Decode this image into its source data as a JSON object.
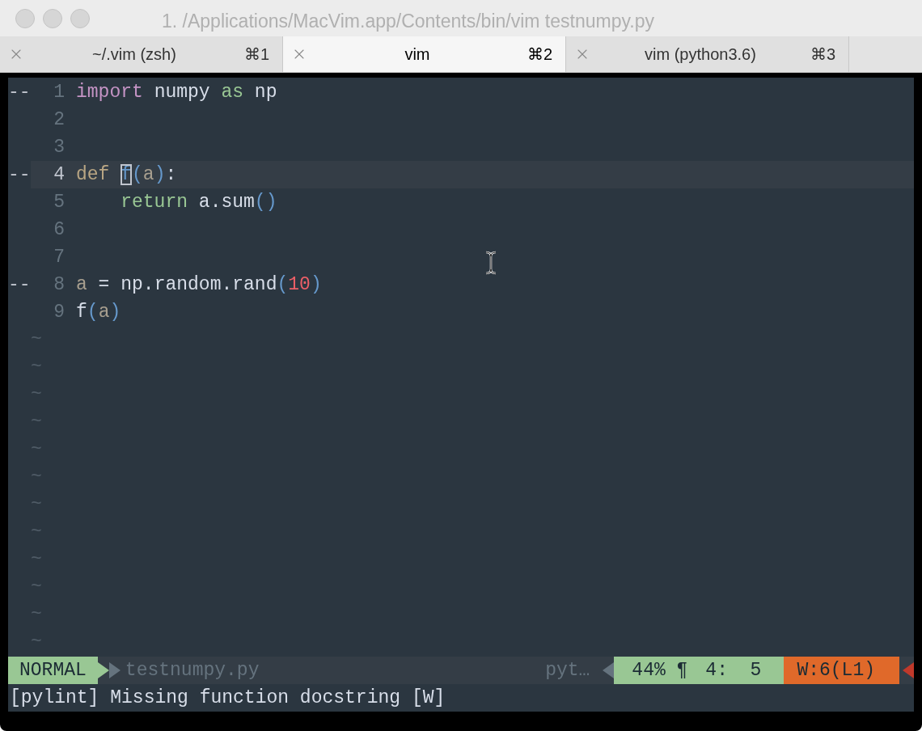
{
  "window": {
    "title": "1. /Applications/MacVim.app/Contents/bin/vim testnumpy.py"
  },
  "tabs": [
    {
      "label": "~/.vim (zsh)",
      "shortcut": "⌘1",
      "selected": false
    },
    {
      "label": "vim",
      "shortcut": "⌘2",
      "selected": true
    },
    {
      "label": "vim (python3.6)",
      "shortcut": "⌘3",
      "selected": false
    }
  ],
  "editor": {
    "lines": [
      {
        "number": "1",
        "sign": "--",
        "current": false,
        "tokens": [
          {
            "text": "import",
            "kind": "include"
          },
          {
            "text": " numpy ",
            "kind": "plain"
          },
          {
            "text": "as",
            "kind": "keyword"
          },
          {
            "text": " np",
            "kind": "plain"
          }
        ]
      },
      {
        "number": "2",
        "current": false
      },
      {
        "number": "3",
        "current": false
      },
      {
        "number": "4",
        "sign": "--",
        "current": true,
        "tokens": [
          {
            "text": "def ",
            "kind": "define"
          },
          {
            "text": "f",
            "kind": "cursor"
          },
          {
            "text": "(",
            "kind": "paren"
          },
          {
            "text": "a",
            "kind": "param"
          },
          {
            "text": ")",
            "kind": "paren"
          },
          {
            "text": ":",
            "kind": "plain"
          }
        ]
      },
      {
        "number": "5",
        "current": false,
        "tokens": [
          {
            "text": "    return",
            "kind": "keyword"
          },
          {
            "text": " a.sum",
            "kind": "plain"
          },
          {
            "text": "()",
            "kind": "paren"
          }
        ]
      },
      {
        "number": "6",
        "current": false
      },
      {
        "number": "7",
        "current": false
      },
      {
        "number": "8",
        "sign": "--",
        "current": false,
        "tokens": [
          {
            "text": "a",
            "kind": "param"
          },
          {
            "text": " = np.random.rand",
            "kind": "plain"
          },
          {
            "text": "(",
            "kind": "paren"
          },
          {
            "text": "10",
            "kind": "number"
          },
          {
            "text": ")",
            "kind": "paren"
          }
        ]
      },
      {
        "number": "9",
        "current": false,
        "tokens": [
          {
            "text": "f",
            "kind": "plain"
          },
          {
            "text": "(",
            "kind": "paren"
          },
          {
            "text": "a",
            "kind": "param"
          },
          {
            "text": ")",
            "kind": "paren"
          }
        ]
      }
    ],
    "filler": [
      "~",
      "~",
      "~",
      "~",
      "~",
      "~",
      "~",
      "~",
      "~",
      "~",
      "~",
      "~"
    ]
  },
  "status_line": {
    "mode": "NORMAL",
    "file": "testnumpy.py",
    "filetype": "pyt…",
    "percent": "44% ¶",
    "position": "4:  5",
    "warnings": "W:6(L1)"
  },
  "command_line": "[pylint] Missing function docstring [W]"
}
